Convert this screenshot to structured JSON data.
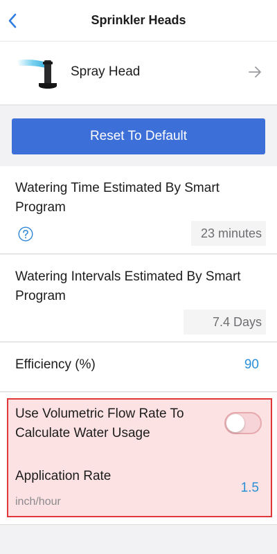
{
  "nav": {
    "title": "Sprinkler Heads"
  },
  "head": {
    "label": "Spray Head"
  },
  "reset_button": {
    "label": "Reset To Default"
  },
  "watering_time": {
    "title": "Watering Time Estimated By Smart Program",
    "value": "23 minutes"
  },
  "watering_intervals": {
    "title": "Watering Intervals Estimated By Smart Program",
    "value": "7.4 Days"
  },
  "efficiency": {
    "label": "Efficiency (%)",
    "value": "90"
  },
  "volumetric": {
    "label": "Use Volumetric Flow Rate To Calculate Water Usage",
    "enabled": false
  },
  "application_rate": {
    "label": "Application Rate",
    "unit": "inch/hour",
    "value": "1.5"
  },
  "colors": {
    "accent": "#3d6fd8",
    "link": "#2b8fd6",
    "highlight_border": "#e0383a",
    "highlight_fill": "#fde2e4"
  },
  "icons": {
    "back": "chevron-left-icon",
    "arrow": "arrow-right-icon",
    "help": "question-circle-icon",
    "head": "spray-head-image"
  }
}
